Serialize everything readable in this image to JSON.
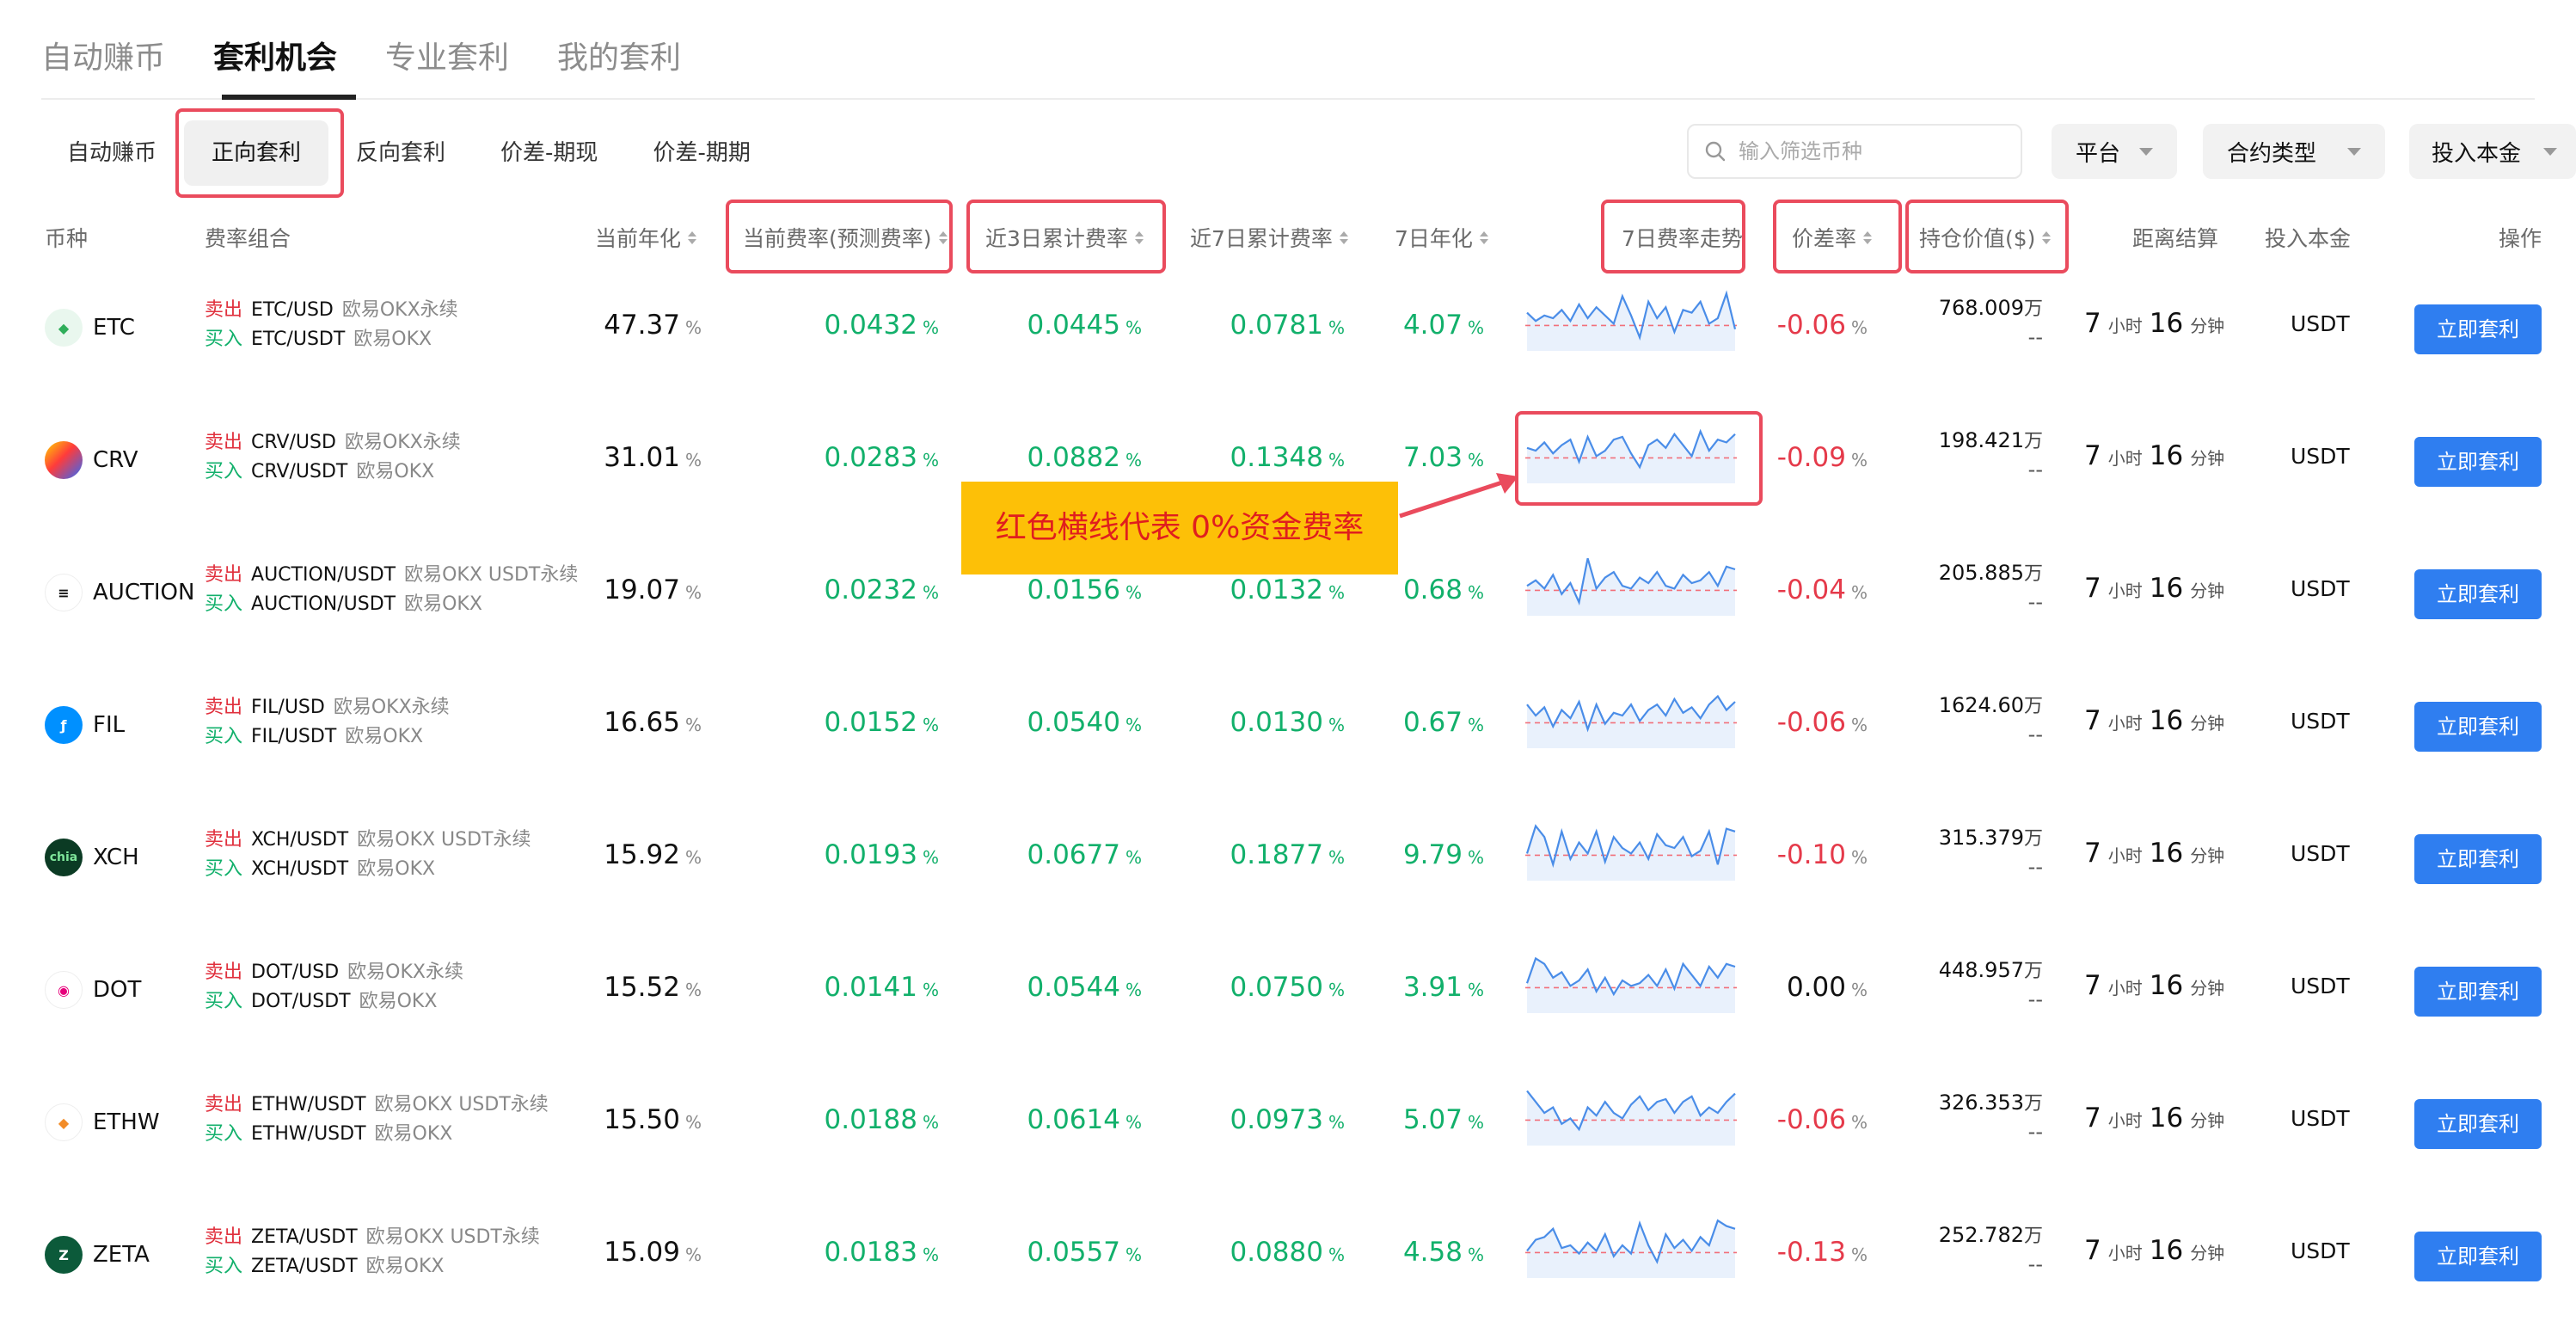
{
  "top_tabs": [
    "自动赚币",
    "套利机会",
    "专业套利",
    "我的套利"
  ],
  "sub_tabs": [
    "自动赚币",
    "正向套利",
    "反向套利",
    "价差-期现",
    "价差-期期"
  ],
  "search": {
    "placeholder": "输入筛选币种"
  },
  "filters": {
    "platform": "平台",
    "contract_type": "合约类型",
    "principal": "投入本金"
  },
  "columns": {
    "coin": "币种",
    "combo": "费率组合",
    "annual": "当前年化",
    "current_rate": "当前费率(预测费率)",
    "rate3d": "近3日累计费率",
    "rate7d": "近7日累计费率",
    "annual7d": "7日年化",
    "trend": "7日费率走势",
    "spread": "价差率",
    "hold": "持仓价值($)",
    "settle": "距离结算",
    "principal": "投入本金",
    "action": "操作"
  },
  "labels": {
    "sell": "卖出",
    "buy": "买入",
    "pct": "%",
    "wan": "万",
    "dash": "--",
    "hour": "小时",
    "minute": "分钟",
    "arb_button": "立即套利"
  },
  "annotation": "红色横线代表 0%资金费率",
  "colors": {
    "green": "#12b06b",
    "red": "#e53a4a",
    "button": "#2f7ef0",
    "highlight": "#ea4b5d",
    "annotation_bg": "#fdc007"
  },
  "rows": [
    {
      "coin": "ETC",
      "icon": "etc-icon",
      "sell_pair": "ETC/USD",
      "sell_ex": "欧易OKX永续",
      "buy_pair": "ETC/USDT",
      "buy_ex": "欧易OKX",
      "annual": "47.37",
      "current_rate": "0.0432",
      "rate3d": "0.0445",
      "rate7d": "0.0781",
      "annual7d": "4.07",
      "spread": "-0.06",
      "hold": "768.009",
      "hours": "7",
      "minutes": "16",
      "principal": "USDT",
      "trend": [
        0.4,
        0.55,
        0.45,
        0.5,
        0.35,
        0.55,
        0.25,
        0.5,
        0.3,
        0.45,
        0.6,
        0.1,
        0.45,
        0.85,
        0.2,
        0.5,
        0.3,
        0.75,
        0.35,
        0.4,
        0.2,
        0.6,
        0.5,
        0.05,
        0.7
      ]
    },
    {
      "coin": "CRV",
      "icon": "crv-icon",
      "sell_pair": "CRV/USD",
      "sell_ex": "欧易OKX永续",
      "buy_pair": "CRV/USDT",
      "buy_ex": "欧易OKX",
      "annual": "31.01",
      "current_rate": "0.0283",
      "rate3d": "0.0882",
      "rate7d": "0.1348",
      "annual7d": "7.03",
      "spread": "-0.09",
      "hold": "198.421",
      "hours": "7",
      "minutes": "16",
      "principal": "USDT",
      "trend": [
        0.45,
        0.5,
        0.35,
        0.55,
        0.4,
        0.3,
        0.7,
        0.25,
        0.6,
        0.5,
        0.3,
        0.25,
        0.55,
        0.8,
        0.4,
        0.3,
        0.45,
        0.2,
        0.4,
        0.6,
        0.15,
        0.5,
        0.3,
        0.35,
        0.2
      ]
    },
    {
      "coin": "AUCTION",
      "icon": "auction-icon",
      "sell_pair": "AUCTION/USDT",
      "sell_ex": "欧易OKX USDT永续",
      "buy_pair": "AUCTION/USDT",
      "buy_ex": "欧易OKX",
      "annual": "19.07",
      "current_rate": "0.0232",
      "rate3d": "0.0156",
      "rate7d": "0.0132",
      "annual7d": "0.68",
      "spread": "-0.04",
      "hold": "205.885",
      "hours": "7",
      "minutes": "16",
      "principal": "USDT",
      "trend": [
        0.55,
        0.45,
        0.6,
        0.35,
        0.7,
        0.5,
        0.85,
        0.05,
        0.6,
        0.4,
        0.3,
        0.55,
        0.6,
        0.4,
        0.5,
        0.3,
        0.55,
        0.6,
        0.35,
        0.5,
        0.45,
        0.3,
        0.55,
        0.2,
        0.25
      ]
    },
    {
      "coin": "FIL",
      "icon": "fil-icon",
      "sell_pair": "FIL/USD",
      "sell_ex": "欧易OKX永续",
      "buy_pair": "FIL/USDT",
      "buy_ex": "欧易OKX",
      "annual": "16.65",
      "current_rate": "0.0152",
      "rate3d": "0.0540",
      "rate7d": "0.0130",
      "annual7d": "0.67",
      "spread": "-0.06",
      "hold": "1624.60",
      "hours": "7",
      "minutes": "16",
      "principal": "USDT",
      "trend": [
        0.3,
        0.5,
        0.35,
        0.7,
        0.4,
        0.55,
        0.25,
        0.75,
        0.3,
        0.65,
        0.45,
        0.5,
        0.3,
        0.6,
        0.4,
        0.3,
        0.5,
        0.2,
        0.45,
        0.35,
        0.55,
        0.3,
        0.15,
        0.4,
        0.25
      ]
    },
    {
      "coin": "XCH",
      "icon": "chia-icon",
      "sell_pair": "XCH/USDT",
      "sell_ex": "欧易OKX USDT永续",
      "buy_pair": "XCH/USDT",
      "buy_ex": "欧易OKX",
      "annual": "15.92",
      "current_rate": "0.0193",
      "rate3d": "0.0677",
      "rate7d": "0.1877",
      "annual7d": "9.79",
      "spread": "-0.10",
      "hold": "315.379",
      "hours": "7",
      "minutes": "16",
      "principal": "USDT",
      "trend": [
        0.6,
        0.1,
        0.3,
        0.8,
        0.2,
        0.7,
        0.4,
        0.6,
        0.2,
        0.75,
        0.3,
        0.5,
        0.6,
        0.4,
        0.7,
        0.25,
        0.45,
        0.5,
        0.3,
        0.65,
        0.55,
        0.2,
        0.8,
        0.15,
        0.2
      ]
    },
    {
      "coin": "DOT",
      "icon": "dot-icon",
      "sell_pair": "DOT/USD",
      "sell_ex": "欧易OKX永续",
      "buy_pair": "DOT/USDT",
      "buy_ex": "欧易OKX",
      "annual": "15.52",
      "current_rate": "0.0141",
      "rate3d": "0.0544",
      "rate7d": "0.0750",
      "annual7d": "3.91",
      "spread": "0.00",
      "hold": "448.957",
      "hours": "7",
      "minutes": "16",
      "principal": "USDT",
      "trend": [
        0.55,
        0.1,
        0.2,
        0.45,
        0.35,
        0.6,
        0.5,
        0.3,
        0.7,
        0.45,
        0.75,
        0.5,
        0.6,
        0.55,
        0.4,
        0.6,
        0.3,
        0.65,
        0.2,
        0.4,
        0.6,
        0.25,
        0.45,
        0.2,
        0.25
      ]
    },
    {
      "coin": "ETHW",
      "icon": "ethw-icon",
      "sell_pair": "ETHW/USDT",
      "sell_ex": "欧易OKX USDT永续",
      "buy_pair": "ETHW/USDT",
      "buy_ex": "欧易OKX",
      "annual": "15.50",
      "current_rate": "0.0188",
      "rate3d": "0.0614",
      "rate7d": "0.0973",
      "annual7d": "5.07",
      "spread": "-0.06",
      "hold": "326.353",
      "hours": "7",
      "minutes": "16",
      "principal": "USDT",
      "trend": [
        0.1,
        0.3,
        0.5,
        0.4,
        0.7,
        0.6,
        0.8,
        0.4,
        0.55,
        0.3,
        0.5,
        0.6,
        0.35,
        0.2,
        0.45,
        0.3,
        0.25,
        0.5,
        0.3,
        0.2,
        0.55,
        0.4,
        0.5,
        0.3,
        0.15
      ]
    },
    {
      "coin": "ZETA",
      "icon": "zeta-icon",
      "sell_pair": "ZETA/USDT",
      "sell_ex": "欧易OKX USDT永续",
      "buy_pair": "ZETA/USDT",
      "buy_ex": "欧易OKX",
      "annual": "15.09",
      "current_rate": "0.0183",
      "rate3d": "0.0557",
      "rate7d": "0.0880",
      "annual7d": "4.58",
      "spread": "-0.13",
      "hold": "252.782",
      "hours": "7",
      "minutes": "16",
      "principal": "USDT",
      "trend": [
        0.6,
        0.4,
        0.35,
        0.2,
        0.55,
        0.5,
        0.65,
        0.45,
        0.6,
        0.3,
        0.7,
        0.5,
        0.65,
        0.1,
        0.5,
        0.8,
        0.3,
        0.55,
        0.4,
        0.6,
        0.35,
        0.5,
        0.05,
        0.15,
        0.2
      ]
    }
  ]
}
